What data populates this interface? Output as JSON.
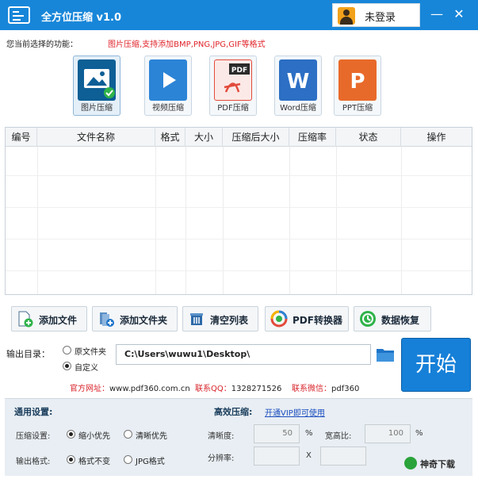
{
  "titlebar": {
    "title": "全方位压缩 v1.0",
    "login_label": "未登录",
    "minimize": "—",
    "close": "✕"
  },
  "function": {
    "label": "您当前选择的功能：",
    "description": "图片压缩,支持添加BMP,PNG,JPG,GIF等格式"
  },
  "tools": [
    {
      "label": "图片压缩",
      "icon": "image-compress-icon",
      "color": "#0d5f96",
      "selected": true
    },
    {
      "label": "视频压缩",
      "icon": "video-compress-icon",
      "color": "#2c84d6"
    },
    {
      "label": "PDF压缩",
      "icon": "pdf-compress-icon",
      "color": "#e24b3b",
      "badge": "PDF"
    },
    {
      "label": "Word压缩",
      "icon": "word-compress-icon",
      "color": "#2c6fc4",
      "letter": "W"
    },
    {
      "label": "PPT压缩",
      "icon": "ppt-compress-icon",
      "color": "#e86a2a",
      "letter": "P"
    }
  ],
  "table": {
    "columns": [
      "编号",
      "文件名称",
      "格式",
      "大小",
      "压缩后大小",
      "压缩率",
      "状态",
      "操作"
    ]
  },
  "actions": [
    {
      "label": "添加文件",
      "icon": "add-file-icon"
    },
    {
      "label": "添加文件夹",
      "icon": "add-folder-icon"
    },
    {
      "label": "清空列表",
      "icon": "clear-list-icon"
    },
    {
      "label": "PDF转换器",
      "icon": "pdf-converter-icon"
    },
    {
      "label": "数据恢复",
      "icon": "data-recovery-icon"
    }
  ],
  "output": {
    "label": "输出目录：",
    "option_original": "原文件夹",
    "option_custom": "自定义",
    "selected": "custom",
    "path": "C:\\Users\\wuwu1\\Desktop\\",
    "start_label": "开始"
  },
  "footer": {
    "site_label": "官方网址：",
    "site": "www.pdf360.com.cn",
    "qq_label": "联系QQ：",
    "qq": "1328271526",
    "wechat_label": "联系微信：",
    "wechat": "pdf360"
  },
  "settings": {
    "general_title": "通用设置:",
    "compress_label": "压缩设置:",
    "compress_opt1": "缩小优先",
    "compress_opt2": "清晰优先",
    "format_label": "输出格式:",
    "format_opt1": "格式不变",
    "format_opt2": "JPG格式",
    "hq_title": "高效压缩:",
    "vip_link": "开通VIP即可使用",
    "clarity_label": "清晰度:",
    "clarity_value": "50",
    "percent": "%",
    "ratio_label": "宽高比:",
    "ratio_value": "100",
    "resolution_label": "分辨率:",
    "times": "X"
  },
  "watermark": "神奇下载"
}
